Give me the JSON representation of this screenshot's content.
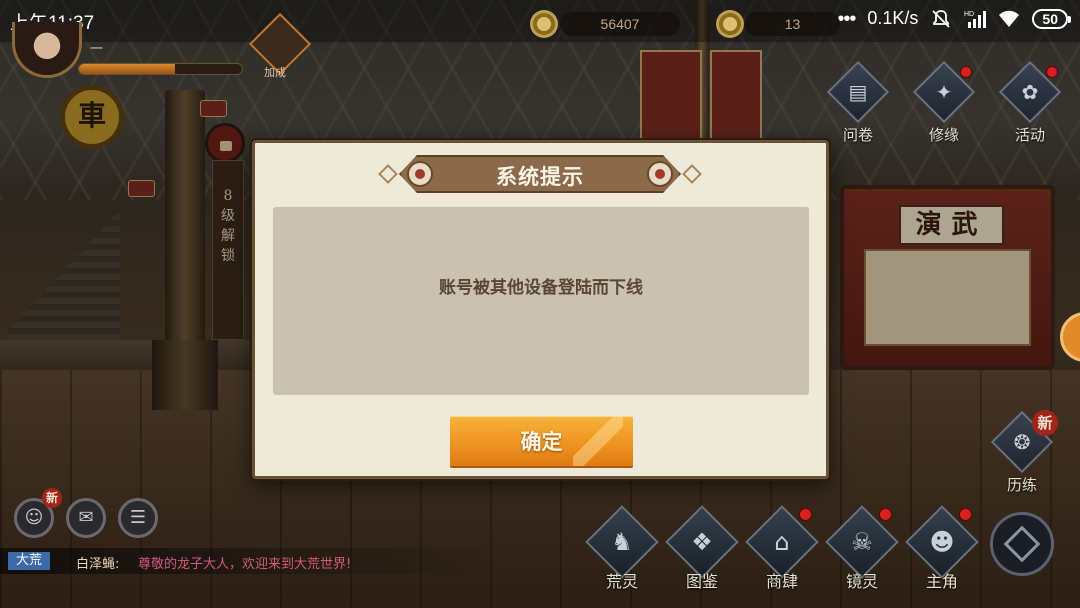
{
  "status_bar": {
    "time": "上午11:37",
    "more_indicator": "•••",
    "net_speed": "0.1K/s",
    "signal_label": "HD",
    "battery": "50",
    "icons": [
      "mute-bell-icon",
      "signal-icon",
      "wifi-icon",
      "battery-icon"
    ]
  },
  "hud": {
    "player_name": "一",
    "xp_fraction": 0.59,
    "boost_label": "加成",
    "currency_1": "56407",
    "currency_2": "13"
  },
  "scene": {
    "vertical_sign": "8级解锁",
    "board_title": "演武",
    "gear_char": "車"
  },
  "top_menu": {
    "questionnaire": "问卷",
    "cultivation": "修缘",
    "events": "活动"
  },
  "side_menu": {
    "experience": "历练",
    "new_badge": "新"
  },
  "bottom_left": {
    "friends_icon": "friends-icon",
    "mail_icon": "mail-icon",
    "tasks_icon": "task-list-icon",
    "new_badge": "新"
  },
  "chat": {
    "channel": "大荒",
    "sender": "白泽蝇:",
    "message": "尊敬的龙子大人，欢迎来到大荒世界!"
  },
  "bottom_nav": [
    {
      "label": "荒灵",
      "dot": false
    },
    {
      "label": "图鉴",
      "dot": false
    },
    {
      "label": "商肆",
      "dot": true
    },
    {
      "label": "镜灵",
      "dot": true
    },
    {
      "label": "主角",
      "dot": true
    }
  ],
  "dialog": {
    "title": "系统提示",
    "message": "账号被其他设备登陆而下线",
    "confirm_label": "确定"
  }
}
